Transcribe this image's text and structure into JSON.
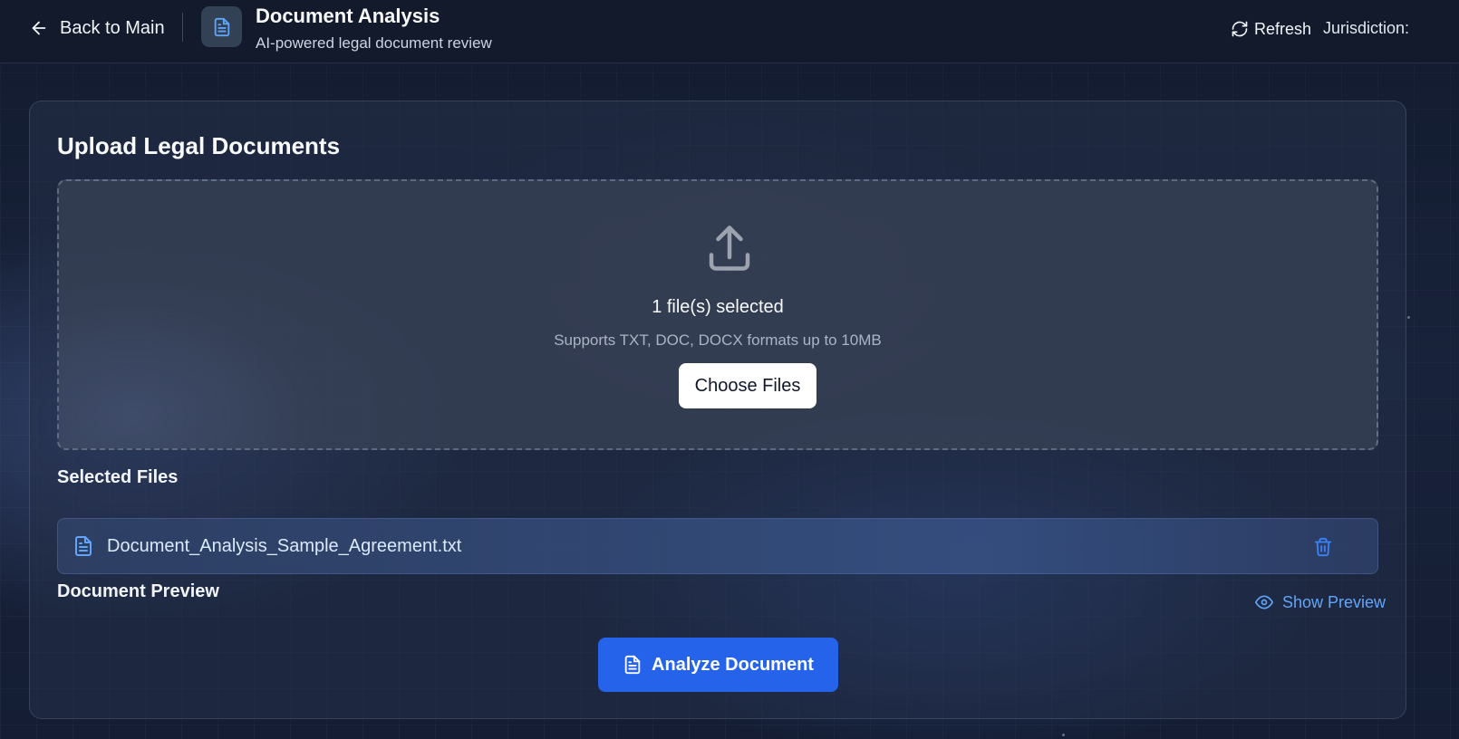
{
  "header": {
    "back_label": "Back to Main",
    "title": "Document Analysis",
    "subtitle": "AI-powered legal document review",
    "refresh_label": "Refresh",
    "jurisdiction_label": "Jurisdiction:"
  },
  "upload": {
    "section_title": "Upload Legal Documents",
    "files_selected_text": "1 file(s) selected",
    "supports_text": "Supports TXT, DOC, DOCX formats up to 10MB",
    "choose_button_label": "Choose Files"
  },
  "selected_files": {
    "heading": "Selected Files",
    "items": [
      {
        "name": "Document_Analysis_Sample_Agreement.txt",
        "icon": "file-text-icon"
      }
    ]
  },
  "preview": {
    "heading": "Document Preview",
    "toggle_label": "Show Preview"
  },
  "actions": {
    "analyze_label": "Analyze Document"
  },
  "colors": {
    "accent": "#2563eb",
    "link": "#60a5fa",
    "icon_blue": "#60a5fa"
  }
}
